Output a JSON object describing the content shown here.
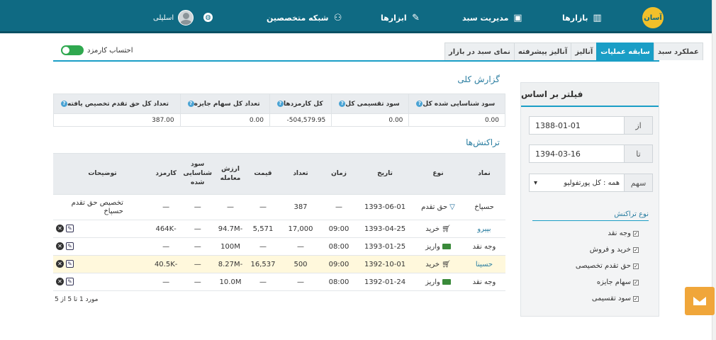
{
  "header": {
    "logo_text": "آسان",
    "nav": [
      {
        "label": "بازارها",
        "icon": "chart-bars-icon"
      },
      {
        "label": "مدیریت سبد",
        "icon": "wallet-icon"
      },
      {
        "label": "ابزارها",
        "icon": "tools-icon"
      },
      {
        "label": "شبکه متخصصین",
        "icon": "network-icon"
      }
    ],
    "user_name": "اسلیلی"
  },
  "tabs": [
    {
      "label": "عملکرد سبد",
      "active": false
    },
    {
      "label": "سابقه عملیات",
      "active": true
    },
    {
      "label": "آنالیز",
      "active": false
    },
    {
      "label": "آنالیز پیشرفته",
      "active": false
    },
    {
      "label": "نمای سبد در بازار",
      "active": false
    }
  ],
  "fee_toggle": {
    "label": "احتساب کارمزد",
    "on": true
  },
  "summary": {
    "title": "گزارش کلی",
    "headers": [
      "سود شناسایی شده کل",
      "سود تقسیمی کل",
      "کل کارمزدها",
      "تعداد کل سهام جایزه",
      "تعداد کل حق تقدم تخصیص یافته"
    ],
    "values": [
      "0.00",
      "0.00",
      "-504,579.95",
      "0.00",
      "387.00"
    ]
  },
  "transactions": {
    "title": "تراکنش‌ها",
    "headers": {
      "symbol": "نماد",
      "type": "نوع",
      "date": "تاریخ",
      "time": "زمان",
      "count": "تعداد",
      "price": "قیمت",
      "value": "ارزش معامله",
      "profit": "سود شناسایی شده",
      "fee": "کارمزد",
      "desc": "توضیحات"
    },
    "rows": [
      {
        "symbol": "حسپاخ",
        "link": false,
        "type": "حق تقدم",
        "type_icon": "triangle-down-icon",
        "date": "1393-06-01",
        "time": "—",
        "count": "387",
        "price": "—",
        "value": "—",
        "profit": "—",
        "fee": "—",
        "desc": "تخصیص حق تقدم حسپاخ",
        "highlight": false,
        "ops": false
      },
      {
        "symbol": "بپیرو",
        "link": true,
        "type": "خرید",
        "type_icon": "cart-icon",
        "date": "1393-04-25",
        "time": "09:00",
        "count": "17,000",
        "price": "5,571",
        "value": "-94.7M",
        "profit": "—",
        "fee": "-464K",
        "desc": "",
        "highlight": false,
        "ops": true
      },
      {
        "symbol": "وجه نقد",
        "link": false,
        "type": "واریز",
        "type_icon": "cash-icon",
        "date": "1393-01-25",
        "time": "08:00",
        "count": "—",
        "price": "—",
        "value": "100M",
        "profit": "—",
        "fee": "—",
        "desc": "",
        "highlight": false,
        "ops": true
      },
      {
        "symbol": "حسینا",
        "link": true,
        "type": "خرید",
        "type_icon": "cart-icon",
        "date": "1392-10-01",
        "time": "09:00",
        "count": "500",
        "price": "16,537",
        "value": "-8.27M",
        "profit": "—",
        "fee": "-40.5K",
        "desc": "",
        "highlight": true,
        "ops": true
      },
      {
        "symbol": "وجه نقد",
        "link": false,
        "type": "واریز",
        "type_icon": "cash-icon",
        "date": "1392-01-24",
        "time": "08:00",
        "count": "—",
        "price": "—",
        "value": "10.0M",
        "profit": "—",
        "fee": "—",
        "desc": "",
        "highlight": false,
        "ops": true
      }
    ],
    "pager": "مورد 1 تا 5 از 5"
  },
  "filter": {
    "title": "فیلتر بر اساس",
    "from_label": "از",
    "from_value": "1388-01-01",
    "to_label": "تا",
    "to_value": "1394-03-16",
    "stock_label": "سهم",
    "stock_value": "همه : کل پورتفولیو",
    "types_title": "نوع تراکنش",
    "types": [
      {
        "label": "وجه نقد",
        "checked": true
      },
      {
        "label": "خرید و فروش",
        "checked": true
      },
      {
        "label": "حق تقدم تخصیصی",
        "checked": true
      },
      {
        "label": "سهام جایزه",
        "checked": true
      },
      {
        "label": "سود تقسیمی",
        "checked": true
      }
    ]
  }
}
